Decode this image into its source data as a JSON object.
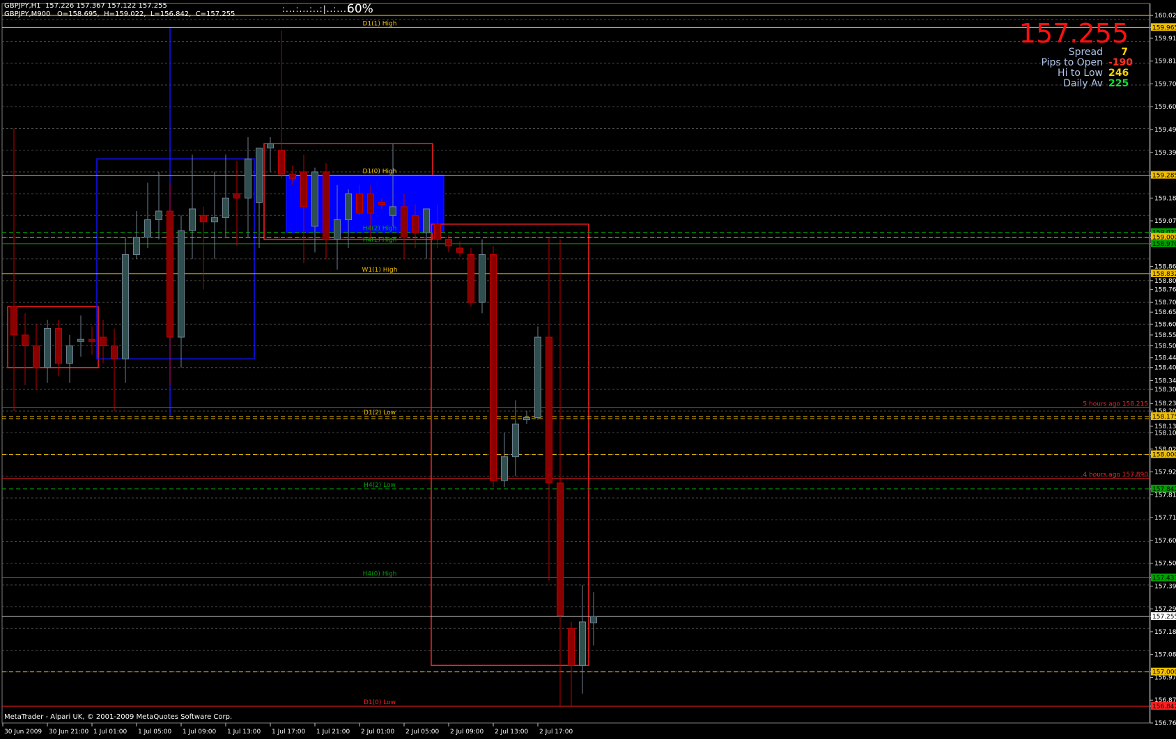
{
  "header": {
    "line1": "GBPJPY,H1  157.226 157.367 157.122 157.255",
    "line2": "GBPJPY,M900   O=158.695,  H=159.022,  L=156.842,  C=157.255"
  },
  "zoom": {
    "dots": ":...:...:..:|..:...:",
    "label": "60%"
  },
  "hud": {
    "price": "157.255",
    "rows": [
      {
        "label": "Spread",
        "value": "7",
        "color": "#ffd700"
      },
      {
        "label": "Pips to Open",
        "value": "-190",
        "color": "#ff3020"
      },
      {
        "label": "Hi to Low",
        "value": "246",
        "color": "#ffd700"
      },
      {
        "label": "Daily Av",
        "value": "225",
        "color": "#10e030"
      }
    ]
  },
  "footer": {
    "copyright": "MetaTrader - Alpari UK, © 2001-2009 MetaQuotes Software Corp."
  },
  "colors": {
    "bull": "#2f4f4f",
    "bear": "#8b0000",
    "wick_bull": "#708090",
    "wick_bear": "#c00000",
    "grid": "#4a4a4a",
    "yellow": "#f0c000",
    "red": "#ff2020",
    "blue": "#1010ff",
    "green": "#00a000"
  },
  "chart_data": {
    "type": "candlestick",
    "symbol": "GBPJPY",
    "timeframe": "H1",
    "y_axis_labels": [
      "160.020",
      "159.965",
      "159.915",
      "159.810",
      "159.705",
      "159.600",
      "159.495",
      "159.390",
      "159.285",
      "159.180",
      "159.075",
      "159.022",
      "159.000",
      "158.970",
      "158.865",
      "158.832",
      "158.800",
      "158.760",
      "158.700",
      "158.655",
      "158.600",
      "158.550",
      "158.500",
      "158.445",
      "158.400",
      "158.340",
      "158.300",
      "158.235",
      "158.200",
      "158.175",
      "158.130",
      "158.100",
      "158.025",
      "158.000",
      "157.920",
      "157.842",
      "157.815",
      "157.710",
      "157.605",
      "157.500",
      "157.433",
      "157.395",
      "157.290",
      "157.255",
      "157.185",
      "157.080",
      "157.000",
      "156.975",
      "156.870",
      "156.842",
      "156.765"
    ],
    "x_axis_labels": [
      "30 Jun 2009",
      "30 Jun 21:00",
      "1 Jul 01:00",
      "1 Jul 05:00",
      "1 Jul 09:00",
      "1 Jul 13:00",
      "1 Jul 17:00",
      "1 Jul 21:00",
      "2 Jul 01:00",
      "2 Jul 05:00",
      "2 Jul 09:00",
      "2 Jul 13:00",
      "2 Jul 17:00"
    ],
    "ylim": [
      156.765,
      160.075
    ],
    "candles": [
      {
        "o": 158.68,
        "h": 159.5,
        "l": 158.2,
        "c": 158.55
      },
      {
        "o": 158.55,
        "h": 158.65,
        "l": 158.32,
        "c": 158.5
      },
      {
        "o": 158.5,
        "h": 158.6,
        "l": 158.3,
        "c": 158.4
      },
      {
        "o": 158.4,
        "h": 158.62,
        "l": 158.33,
        "c": 158.58
      },
      {
        "o": 158.58,
        "h": 158.62,
        "l": 158.36,
        "c": 158.42
      },
      {
        "o": 158.42,
        "h": 158.55,
        "l": 158.33,
        "c": 158.5
      },
      {
        "o": 158.52,
        "h": 158.64,
        "l": 158.45,
        "c": 158.53
      },
      {
        "o": 158.53,
        "h": 158.59,
        "l": 158.46,
        "c": 158.52
      },
      {
        "o": 158.54,
        "h": 158.62,
        "l": 158.42,
        "c": 158.5
      },
      {
        "o": 158.5,
        "h": 158.58,
        "l": 158.2,
        "c": 158.44
      },
      {
        "o": 158.44,
        "h": 159.0,
        "l": 158.33,
        "c": 158.92
      },
      {
        "o": 158.92,
        "h": 159.12,
        "l": 158.9,
        "c": 159.0
      },
      {
        "o": 159.0,
        "h": 159.25,
        "l": 158.95,
        "c": 159.08
      },
      {
        "o": 159.08,
        "h": 159.3,
        "l": 158.99,
        "c": 159.12
      },
      {
        "o": 159.12,
        "h": 159.25,
        "l": 158.32,
        "c": 158.54
      },
      {
        "o": 158.54,
        "h": 159.1,
        "l": 158.4,
        "c": 159.03
      },
      {
        "o": 159.03,
        "h": 159.38,
        "l": 158.9,
        "c": 159.13
      },
      {
        "o": 159.1,
        "h": 159.14,
        "l": 158.76,
        "c": 159.07
      },
      {
        "o": 159.07,
        "h": 159.3,
        "l": 158.9,
        "c": 159.09
      },
      {
        "o": 159.09,
        "h": 159.38,
        "l": 159.0,
        "c": 159.18
      },
      {
        "o": 159.2,
        "h": 159.35,
        "l": 158.96,
        "c": 159.18
      },
      {
        "o": 159.18,
        "h": 159.46,
        "l": 159.0,
        "c": 159.36
      },
      {
        "o": 159.16,
        "h": 159.38,
        "l": 158.95,
        "c": 159.41
      },
      {
        "o": 159.41,
        "h": 159.46,
        "l": 159.3,
        "c": 159.43
      },
      {
        "o": 159.4,
        "h": 159.95,
        "l": 159.27,
        "c": 159.29
      },
      {
        "o": 159.29,
        "h": 159.33,
        "l": 159.24,
        "c": 159.27
      },
      {
        "o": 159.3,
        "h": 159.38,
        "l": 158.88,
        "c": 159.14
      },
      {
        "o": 159.05,
        "h": 159.32,
        "l": 158.93,
        "c": 159.3
      },
      {
        "o": 159.3,
        "h": 159.34,
        "l": 158.9,
        "c": 158.99
      },
      {
        "o": 158.99,
        "h": 159.24,
        "l": 158.85,
        "c": 159.08
      },
      {
        "o": 159.08,
        "h": 159.22,
        "l": 158.95,
        "c": 159.2
      },
      {
        "o": 159.2,
        "h": 159.24,
        "l": 159.1,
        "c": 159.11
      },
      {
        "o": 159.2,
        "h": 159.24,
        "l": 158.99,
        "c": 159.11
      },
      {
        "o": 159.16,
        "h": 159.18,
        "l": 159.13,
        "c": 159.15
      },
      {
        "o": 159.1,
        "h": 159.43,
        "l": 159.05,
        "c": 159.14
      },
      {
        "o": 159.14,
        "h": 159.2,
        "l": 158.9,
        "c": 159.0
      },
      {
        "o": 159.1,
        "h": 159.15,
        "l": 158.95,
        "c": 159.02
      },
      {
        "o": 159.02,
        "h": 159.1,
        "l": 158.9,
        "c": 159.13
      },
      {
        "o": 159.06,
        "h": 159.15,
        "l": 158.95,
        "c": 158.99
      },
      {
        "o": 158.99,
        "h": 159.01,
        "l": 158.93,
        "c": 158.96
      },
      {
        "o": 158.95,
        "h": 158.98,
        "l": 158.91,
        "c": 158.93
      },
      {
        "o": 158.92,
        "h": 158.95,
        "l": 158.68,
        "c": 158.7
      },
      {
        "o": 158.7,
        "h": 158.99,
        "l": 158.65,
        "c": 158.92
      },
      {
        "o": 158.92,
        "h": 158.96,
        "l": 157.85,
        "c": 157.88
      },
      {
        "o": 157.88,
        "h": 158.1,
        "l": 157.85,
        "c": 157.99
      },
      {
        "o": 157.99,
        "h": 158.25,
        "l": 157.9,
        "c": 158.14
      },
      {
        "o": 158.16,
        "h": 158.2,
        "l": 158.14,
        "c": 158.17
      },
      {
        "o": 158.17,
        "h": 158.59,
        "l": 158.16,
        "c": 158.54
      },
      {
        "o": 158.54,
        "h": 159.0,
        "l": 157.42,
        "c": 157.87
      },
      {
        "o": 157.87,
        "h": 158.99,
        "l": 156.842,
        "c": 157.26
      },
      {
        "o": 157.2,
        "h": 157.23,
        "l": 156.842,
        "c": 157.03
      },
      {
        "o": 157.03,
        "h": 157.4,
        "l": 156.9,
        "c": 157.23
      },
      {
        "o": 157.226,
        "h": 157.367,
        "l": 157.122,
        "c": 157.255
      }
    ],
    "levels": [
      {
        "price": 160.02,
        "color": "#f0c000",
        "style": "solid",
        "label": ""
      },
      {
        "price": 159.965,
        "color": "#f0c000",
        "style": "solid",
        "label": "D1(1) High"
      },
      {
        "price": 159.285,
        "color": "#f0c000",
        "style": "solid",
        "label": "D1(0) High"
      },
      {
        "price": 159.022,
        "color": "#00a000",
        "style": "dash",
        "label": "H4(2) High"
      },
      {
        "price": 159.0,
        "color": "#f0c000",
        "style": "dash",
        "label": ""
      },
      {
        "price": 158.97,
        "color": "#00a000",
        "style": "solid",
        "label": "H4(1) High"
      },
      {
        "price": 158.832,
        "color": "#f0c000",
        "style": "solid",
        "label": "W1(1) High"
      },
      {
        "price": 158.215,
        "color": "#ff2020",
        "style": "solid",
        "label": "5 hours ago 158.215"
      },
      {
        "price": 158.175,
        "color": "#f0c000",
        "style": "dash",
        "label": "D1(2) Low"
      },
      {
        "price": 158.165,
        "color": "#f0c000",
        "style": "dash",
        "label": ""
      },
      {
        "price": 158.0,
        "color": "#f0c000",
        "style": "dash",
        "label": ""
      },
      {
        "price": 157.89,
        "color": "#ff2020",
        "style": "solid",
        "label": "4 hours ago 157.890"
      },
      {
        "price": 157.842,
        "color": "#00a000",
        "style": "dash",
        "label": "H4(2) Low"
      },
      {
        "price": 157.433,
        "color": "#00a000",
        "style": "solid",
        "label": "H4(0) High"
      },
      {
        "price": 157.255,
        "color": "#c0c0c0",
        "style": "solid",
        "label": ""
      },
      {
        "price": 157.0,
        "color": "#f0c000",
        "style": "dash",
        "label": ""
      },
      {
        "price": 156.842,
        "color": "#ff2020",
        "style": "solid",
        "label": "D1(0) Low"
      }
    ],
    "axis_highlights": [
      {
        "price": 159.965,
        "bg": "#f0c000",
        "fg": "#000"
      },
      {
        "price": 159.285,
        "bg": "#f0c000",
        "fg": "#000"
      },
      {
        "price": 159.022,
        "bg": "#00a000",
        "fg": "#000"
      },
      {
        "price": 159.0,
        "bg": "#f0c000",
        "fg": "#000"
      },
      {
        "price": 158.97,
        "bg": "#00a000",
        "fg": "#000"
      },
      {
        "price": 158.832,
        "bg": "#f0c000",
        "fg": "#000"
      },
      {
        "price": 158.175,
        "bg": "#f0c000",
        "fg": "#000"
      },
      {
        "price": 158.0,
        "bg": "#f0c000",
        "fg": "#000"
      },
      {
        "price": 157.842,
        "bg": "#00a000",
        "fg": "#000"
      },
      {
        "price": 157.433,
        "bg": "#00a000",
        "fg": "#000"
      },
      {
        "price": 157.255,
        "bg": "#ffffff",
        "fg": "#000"
      },
      {
        "price": 157.0,
        "bg": "#f0c000",
        "fg": "#000"
      },
      {
        "price": 156.842,
        "bg": "#ff2020",
        "fg": "#000"
      }
    ]
  }
}
